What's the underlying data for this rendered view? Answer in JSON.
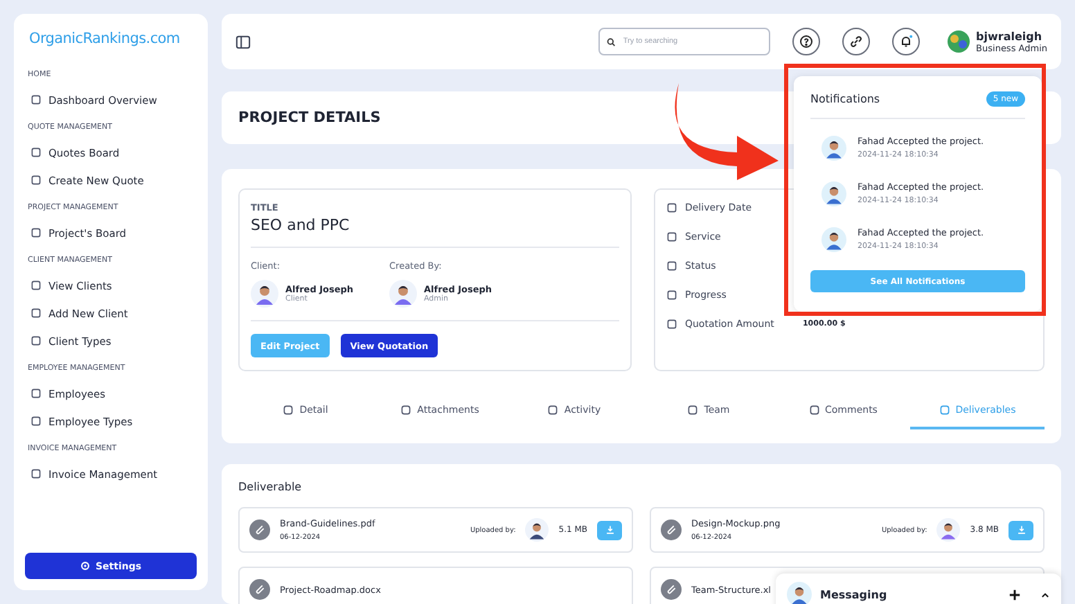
{
  "sidebar": {
    "logo": "OrganicRankings.com",
    "sections": [
      {
        "heading": "HOME",
        "items": [
          {
            "label": "Dashboard Overview"
          }
        ]
      },
      {
        "heading": "QUOTE MANAGEMENT",
        "items": [
          {
            "label": "Quotes Board"
          },
          {
            "label": "Create New Quote"
          }
        ]
      },
      {
        "heading": "PROJECT MANAGEMENT",
        "items": [
          {
            "label": "Project's Board"
          }
        ]
      },
      {
        "heading": "CLIENT MANAGEMENT",
        "items": [
          {
            "label": "View Clients"
          },
          {
            "label": "Add New Client"
          },
          {
            "label": "Client Types"
          }
        ]
      },
      {
        "heading": "EMPLOYEE MANAGEMENT",
        "items": [
          {
            "label": "Employees"
          },
          {
            "label": "Employee Types"
          }
        ]
      },
      {
        "heading": "INVOICE MANAGEMENT",
        "items": [
          {
            "label": "Invoice Management"
          }
        ]
      }
    ],
    "settings": "Settings"
  },
  "header": {
    "search": {
      "placeholder": "Try to searching"
    },
    "user": {
      "name": "bjwraleigh",
      "role": "Business Admin"
    }
  },
  "page_title": "PROJECT DETAILS",
  "project": {
    "title_label": "TITLE",
    "title": "SEO and PPC",
    "people": [
      {
        "label": "Client:",
        "name": "Alfred Joseph",
        "role": "Client"
      },
      {
        "label": "Created By:",
        "name": "Alfred Joseph",
        "role": "Admin"
      }
    ],
    "buttons": [
      {
        "label": "Edit Project",
        "kind": "light"
      },
      {
        "label": "View Quotation",
        "kind": "dark"
      }
    ],
    "info": [
      {
        "label": "Delivery Date"
      },
      {
        "label": "Service"
      },
      {
        "label": "Status"
      },
      {
        "label": "Progress"
      },
      {
        "label": "Quotation Amount",
        "value": "1000.00 $"
      }
    ]
  },
  "tabs": [
    {
      "label": "Detail",
      "selected": false
    },
    {
      "label": "Attachments",
      "selected": false
    },
    {
      "label": "Activity",
      "selected": false
    },
    {
      "label": "Team",
      "selected": false
    },
    {
      "label": "Comments",
      "selected": false
    },
    {
      "label": "Deliverables",
      "selected": true
    }
  ],
  "deliverables": {
    "heading": "Deliverable",
    "files": [
      {
        "name": "Brand-Guidelines.pdf",
        "date": "06-12-2024",
        "uploaded_label": "Uploaded by:",
        "size": "5.1 MB"
      },
      {
        "name": "Design-Mockup.png",
        "date": "06-12-2024",
        "uploaded_label": "Uploaded by:",
        "size": "3.8 MB"
      },
      {
        "name": "Project-Roadmap.docx"
      },
      {
        "name": "Team-Structure.xl"
      }
    ]
  },
  "notifications": {
    "title": "Notifications",
    "badge": "5 new",
    "items": [
      {
        "text": "Fahad Accepted the project.",
        "time": "2024-11-24 18:10:34"
      },
      {
        "text": "Fahad Accepted the project.",
        "time": "2024-11-24 18:10:34"
      },
      {
        "text": "Fahad Accepted the project.",
        "time": "2024-11-24 18:10:34"
      }
    ],
    "button": "See All Notifications"
  },
  "messaging": {
    "title": "Messaging"
  }
}
